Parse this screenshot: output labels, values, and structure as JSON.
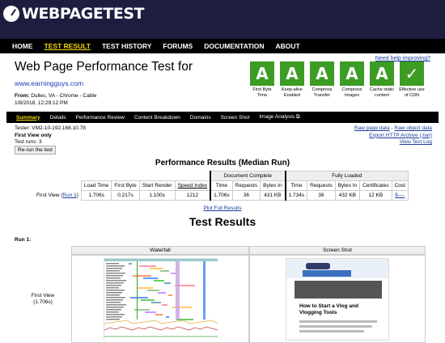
{
  "brand": {
    "logo_text": "WEBPAGETEST"
  },
  "nav": [
    "HOME",
    "TEST RESULT",
    "TEST HISTORY",
    "FORUMS",
    "DOCUMENTATION",
    "ABOUT"
  ],
  "nav_active": 1,
  "header": {
    "need_help": "Need help improving?",
    "title": "Web Page Performance Test for",
    "url": "www.earningguys.com",
    "from_label": "From:",
    "from_value": "Dulles, VA - Chrome - Cable",
    "datetime": "1/8/2018, 12:29:12 PM"
  },
  "grades": [
    {
      "grade": "A",
      "label": "First Byte Time"
    },
    {
      "grade": "A",
      "label": "Keep-alive Enabled"
    },
    {
      "grade": "A",
      "label": "Compress Transfer"
    },
    {
      "grade": "A",
      "label": "Compress Images"
    },
    {
      "grade": "A",
      "label": "Cache static content"
    },
    {
      "grade": "✓",
      "label": "Effective use of CDN"
    }
  ],
  "subnav": [
    "Summary",
    "Details",
    "Performance Review",
    "Content Breakdown",
    "Domains",
    "Screen Shot",
    "Image Analysis ⧉"
  ],
  "subnav_active": 0,
  "tester": {
    "tester": "Tester: VM2-10-192.168.10.78",
    "view": "First View only",
    "runs": "Test runs: 3",
    "rerun": "Re-run the test"
  },
  "raw_links": {
    "raw_page": "Raw page data",
    "sep": " - ",
    "raw_object": "Raw object data",
    "export": "Export HTTP Archive (.har)",
    "view_log": "View Test Log"
  },
  "perf": {
    "title": "Performance Results (Median Run)",
    "group_document": "Document Complete",
    "group_fully": "Fully Loaded",
    "columns": [
      "Load Time",
      "First Byte",
      "Start Render",
      "Speed Index",
      "Time",
      "Requests",
      "Bytes In",
      "Time",
      "Requests",
      "Bytes In",
      "Certificates",
      "Cost"
    ],
    "row_label": "First View (",
    "row_link": "Run 1",
    "row_close": ")",
    "values": [
      "1.706s",
      "0.217s",
      "1.100s",
      "1212",
      "1.706s",
      "36",
      "431 KB",
      "1.734s",
      "36",
      "432 KB",
      "12 KB",
      "$----"
    ],
    "plot_full": "Plot Full Results"
  },
  "test_results": {
    "title": "Test Results",
    "run_label": "Run 1:",
    "waterfall_header": "Waterfall",
    "screenshot_header": "Screen Shot",
    "first_view": "First View",
    "first_view_time": "(1.706s)",
    "screenshot_title": "How to Start a Vlog and Vlogging Tools"
  },
  "colors": {
    "header_bg": "#1d1e3f",
    "nav_bg": "#000000",
    "active_nav": "#f5d90a",
    "grade_green": "#3c9c23",
    "link": "#1a3c9b"
  }
}
